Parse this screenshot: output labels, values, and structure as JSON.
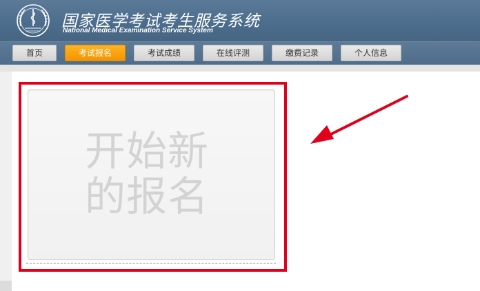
{
  "header": {
    "title_cn": "国家医学考试考生服务系统",
    "title_en": "National Medical Examination Service System"
  },
  "nav": {
    "items": [
      {
        "label": "首页",
        "active": false
      },
      {
        "label": "考试报名",
        "active": true
      },
      {
        "label": "考试成绩",
        "active": false
      },
      {
        "label": "在线评测",
        "active": false
      },
      {
        "label": "缴费记录",
        "active": false
      },
      {
        "label": "个人信息",
        "active": false
      }
    ]
  },
  "main": {
    "new_registration": {
      "line1": "开始新",
      "line2": "的报名"
    }
  },
  "colors": {
    "header_bg": "#4d6d8d",
    "active_tab": "#f49400",
    "highlight_frame": "#e0001b",
    "annotation_arrow": "#e0001b"
  }
}
